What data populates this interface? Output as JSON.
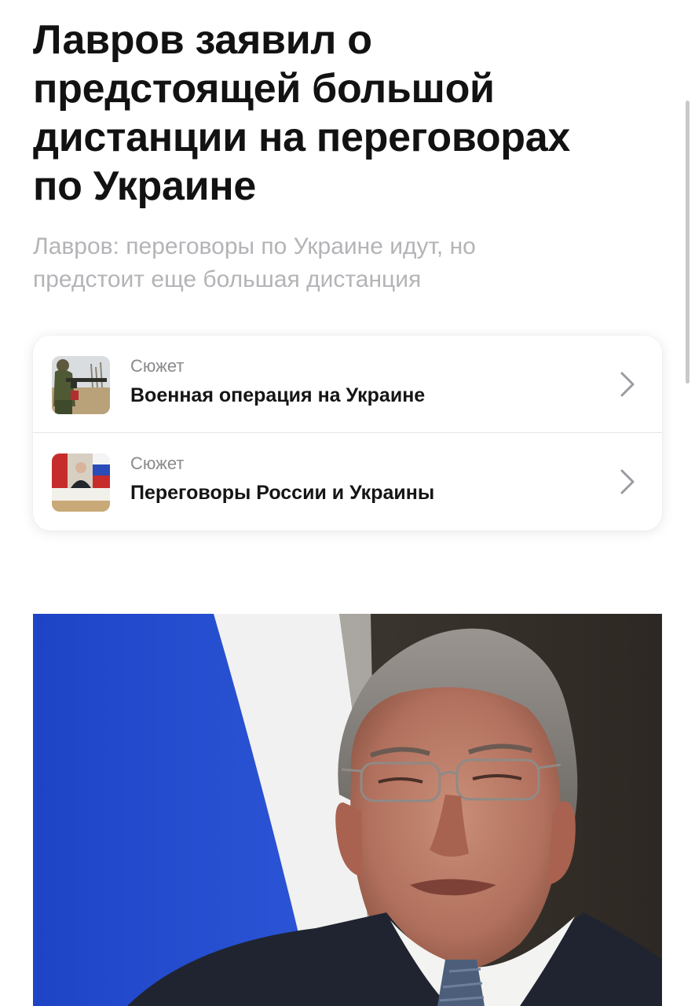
{
  "article": {
    "headline_lines": [
      "Лавров заявил о",
      "предстоящей большой",
      "дистанции на переговорах",
      "по Украине"
    ],
    "subtitle_lines": [
      "Лавров: переговоры по Украине идут, но",
      "предстоит еще большая дистанция"
    ]
  },
  "stories": [
    {
      "kicker": "Сюжет",
      "title": "Военная операция на Украине",
      "thumbnail_icon": "soldier-photo-thumbnail"
    },
    {
      "kicker": "Сюжет",
      "title": "Переговоры России и Украины",
      "thumbnail_icon": "meeting-photo-thumbnail"
    }
  ],
  "hero_image": {
    "description_icon": "lavrov-portrait-photo"
  },
  "colors": {
    "headline": "#121212",
    "subtitle": "#b4b4b8",
    "kicker": "#8a8a8e",
    "chevron": "#9a9aa0",
    "flag_blue": "#1f47c4",
    "flag_white": "#f4f4f4",
    "background_dark": "#3a3530"
  }
}
